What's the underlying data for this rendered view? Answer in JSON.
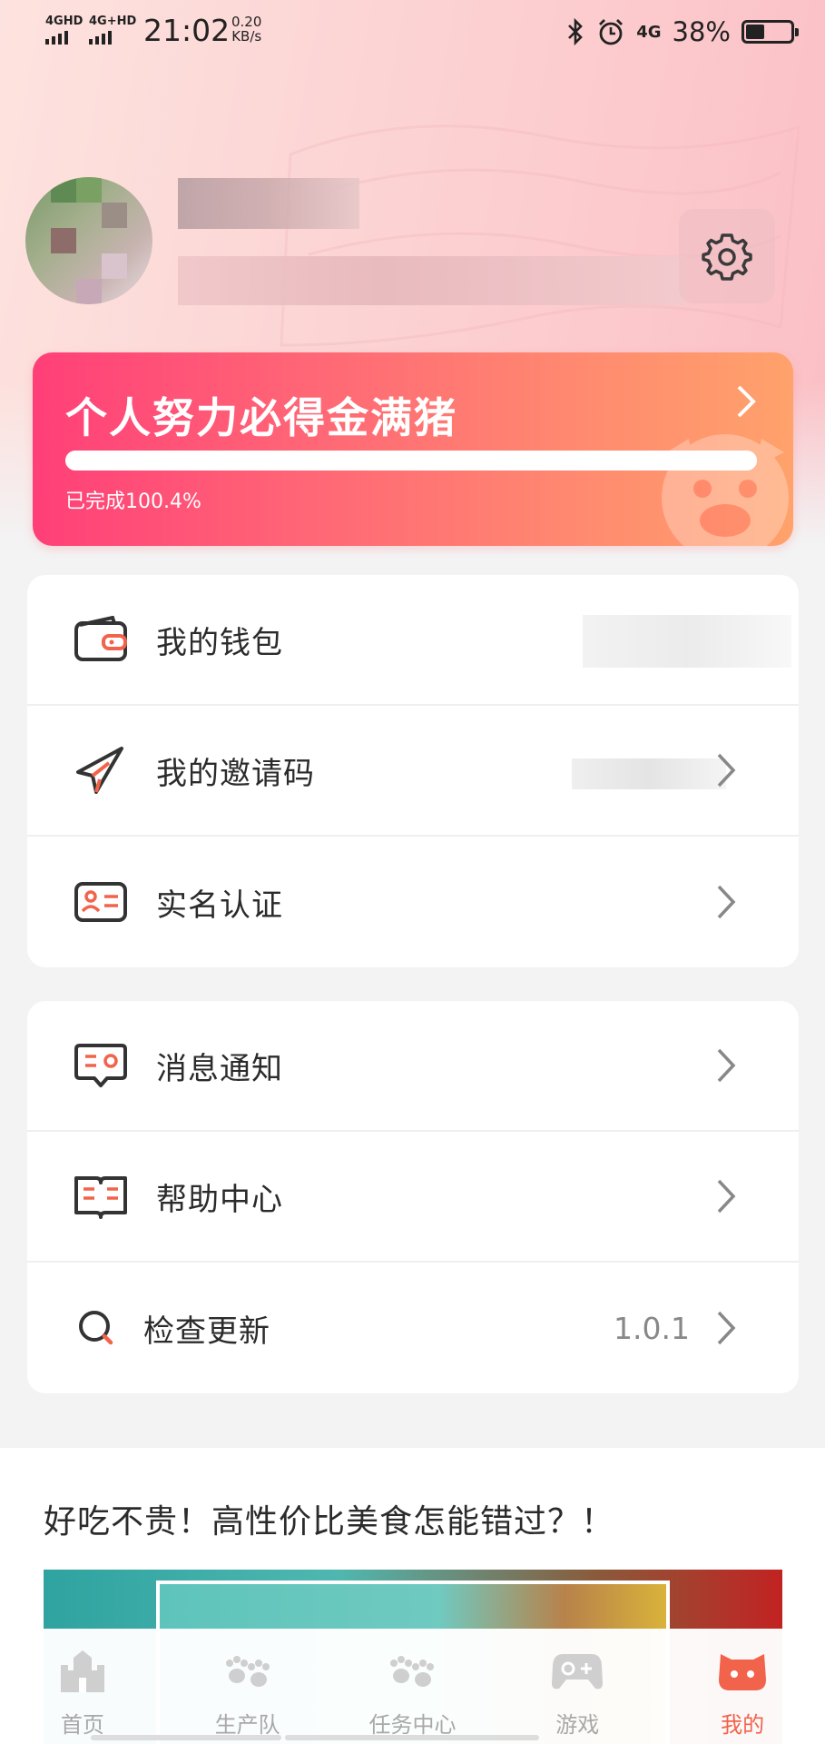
{
  "status_bar": {
    "signal1": "4GHD",
    "signal2": "4G+HD",
    "time": "21:02",
    "net_speed_value": "0.20",
    "net_speed_unit": "KB/s",
    "network_right": "4G",
    "battery_pct": "38%",
    "battery_level": 0.38
  },
  "profile": {
    "avatar_icon": "avatar-blurred",
    "settings_icon": "gear-icon"
  },
  "banner": {
    "title": "个人努力必得金满猪",
    "progress_text": "已完成100.4%",
    "progress_fraction": 1.0,
    "colors": {
      "start": "#ff3f78",
      "end": "#ffa26b"
    }
  },
  "account_menu": {
    "items": [
      {
        "label": "我的钱包",
        "icon": "wallet-icon"
      },
      {
        "label": "我的邀请码",
        "icon": "paper-plane-icon"
      },
      {
        "label": "实名认证",
        "icon": "id-card-icon"
      }
    ]
  },
  "general_menu": {
    "items": [
      {
        "label": "消息通知",
        "icon": "message-icon"
      },
      {
        "label": "帮助中心",
        "icon": "help-book-icon"
      },
      {
        "label": "检查更新",
        "icon": "search-icon",
        "value": "1.0.1"
      }
    ]
  },
  "promo": {
    "title": "好吃不贵！高性价比美食怎能错过？！"
  },
  "tabbar": {
    "tabs": [
      {
        "label": "首页",
        "icon": "castle-icon",
        "active": false
      },
      {
        "label": "生产队",
        "icon": "paw-icon",
        "active": false
      },
      {
        "label": "任务中心",
        "icon": "paw-icon",
        "active": false
      },
      {
        "label": "游戏",
        "icon": "gamepad-icon",
        "active": false
      },
      {
        "label": "我的",
        "icon": "cat-face-icon",
        "active": true
      }
    ],
    "active_color": "#f2634b",
    "inactive_color": "#a8a8a8"
  }
}
